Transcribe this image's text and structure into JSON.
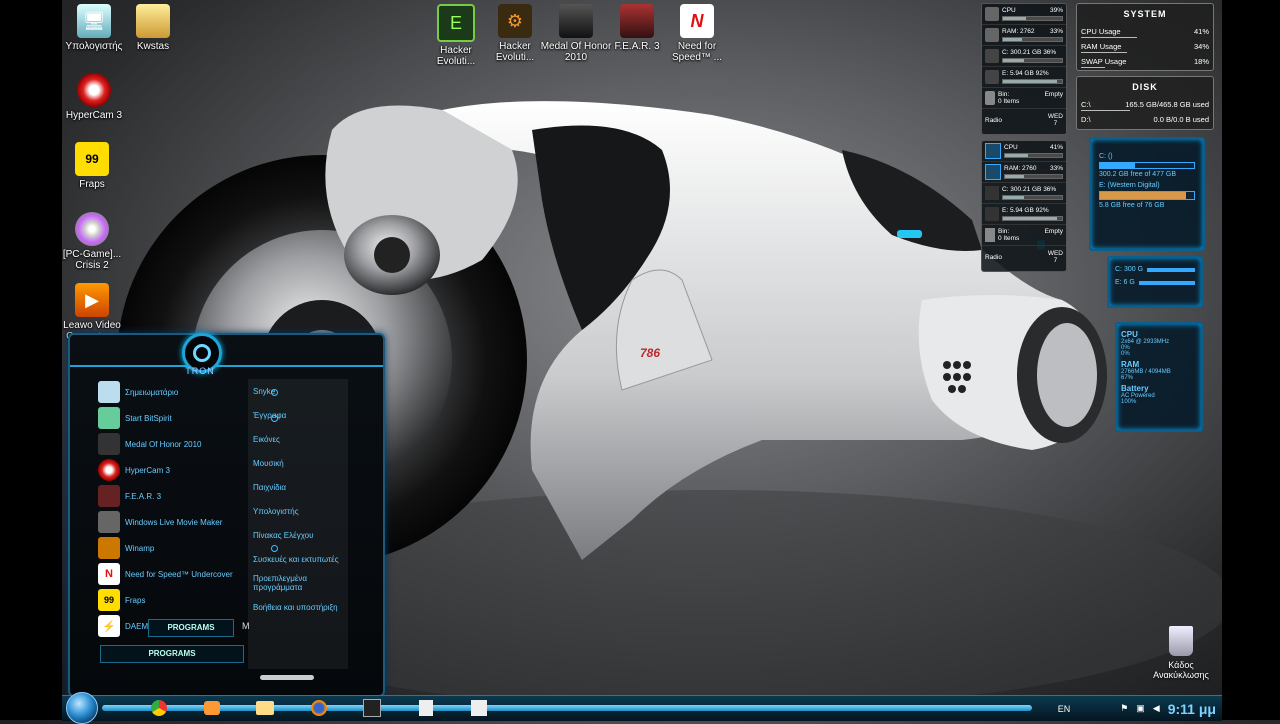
{
  "desktop_icons": [
    {
      "label": "Υπολογιστής",
      "icon": "computer-icon"
    },
    {
      "label": "Kwstas",
      "icon": "folder-icon"
    },
    {
      "label": "HyperCam 3",
      "icon": "hypercam-icon"
    },
    {
      "label": "Fraps",
      "icon": "fraps-icon"
    },
    {
      "label": "[PC-Game]... Crisis 2",
      "icon": "disc-icon"
    },
    {
      "label": "Leawo Video Converter...",
      "icon": "video-converter-icon"
    },
    {
      "label": "Hacker Evoluti...",
      "icon": "hacker-evolution-icon"
    },
    {
      "label": "Hacker Evoluti...",
      "icon": "hacker-evolution-2-icon"
    },
    {
      "label": "Medal Of Honor 2010",
      "icon": "medal-of-honor-icon"
    },
    {
      "label": "F.E.A.R. 3",
      "icon": "fear3-icon"
    },
    {
      "label": "Need for Speed™ ...",
      "icon": "need-for-speed-icon"
    }
  ],
  "recycle_bin": {
    "label": "Κάδος Ανακύκλωσης"
  },
  "wallpaper": {
    "bike_number": "786"
  },
  "meter1": {
    "cpu_label": "CPU",
    "cpu_value": "39%",
    "cpu_pct": 39,
    "ram_label": "RAM: 2762",
    "ram_value": "33%",
    "ram_pct": 33,
    "c_drive": "C: 300.21 GB 36%",
    "c_pct": 36,
    "e_drive": "E: 5.94 GB 92%",
    "e_pct": 92,
    "bin_label": "Bin:",
    "bin_status": "Empty",
    "bin_items": "0 Items",
    "radio_label": "Radio",
    "day": "WED",
    "date": "7"
  },
  "meter2": {
    "cpu_label": "CPU",
    "cpu_value": "41%",
    "cpu_pct": 41,
    "ram_label": "RAM: 2760",
    "ram_value": "33%",
    "ram_pct": 33,
    "c_drive": "C: 300.21 GB 36%",
    "c_pct": 36,
    "e_drive": "E: 5.94 GB 92%",
    "e_pct": 92,
    "bin_label": "Bin:",
    "bin_status": "Empty",
    "bin_items": "0 Items",
    "radio_label": "Radio",
    "day": "WED",
    "date": "7"
  },
  "system_gadget": {
    "title": "SYSTEM",
    "rows": [
      {
        "label": "CPU Usage",
        "value": "41%",
        "pct": 41
      },
      {
        "label": "RAM Usage",
        "value": "34%",
        "pct": 34
      },
      {
        "label": "SWAP Usage",
        "value": "18%",
        "pct": 18
      }
    ]
  },
  "disk_gadget": {
    "title": "DISK",
    "rows": [
      {
        "label": "C:\\",
        "value": "165.5 GB/465.8 GB used",
        "pct": 36
      },
      {
        "label": "D:\\",
        "value": "0.0 B/0.0 B used",
        "pct": 0
      }
    ]
  },
  "drive_gadget": {
    "c_label": "C: ()",
    "c_free": "300.2 GB free of 477 GB",
    "c_pct": 37,
    "e_label": "E: (Western Digital)",
    "e_free": "5.8 GB free of 76 GB",
    "e_pct": 92
  },
  "small_drive_gadget": {
    "c": "C: 300 G",
    "e": "E: 6 G"
  },
  "cpu_gadget": {
    "cpu_title": "CPU",
    "cpu_spec": "2x64 @ 2933MHz",
    "core1": "0%",
    "core2": "0%",
    "ram_title": "RAM",
    "ram_value": "2766MB / 4094MB",
    "ram_pct": "67%",
    "battery_title": "Battery",
    "battery_status": "AC Powered",
    "battery_pct": "100%"
  },
  "start_menu": {
    "title": "TRON",
    "items": [
      {
        "label": "Σημειωματάριο",
        "icon": "notepad-icon"
      },
      {
        "label": "Start BitSpirit",
        "icon": "bitspirit-icon"
      },
      {
        "label": "Medal Of Honor 2010",
        "icon": "medal-of-honor-icon"
      },
      {
        "label": "HyperCam 3",
        "icon": "hypercam-icon"
      },
      {
        "label": "F.E.A.R. 3",
        "icon": "fear3-icon"
      },
      {
        "label": "Windows Live Movie Maker",
        "icon": "movie-maker-icon"
      },
      {
        "label": "Winamp",
        "icon": "winamp-icon"
      },
      {
        "label": "Need for Speed™ Undercover",
        "icon": "need-for-speed-icon"
      },
      {
        "label": "Fraps",
        "icon": "fraps-icon"
      },
      {
        "label": "DAEMON",
        "icon": "daemon-tools-icon"
      }
    ],
    "places": [
      "Snyke",
      "Έγγραφα",
      "Εικόνες",
      "Μουσική",
      "Παιχνίδια",
      "Υπολογιστής",
      "Πίνακας Ελέγχου",
      "Συσκευές και εκτυπωτές",
      "Προεπιλεγμένα προγράμματα",
      "Βοήθεια και υποστήριξη"
    ],
    "programs_label": "PROGRAMS",
    "programs_label_2": "PROGRAMS",
    "overflow_label": "M"
  },
  "taskbar": {
    "language": "EN",
    "clock": "9:11 μμ",
    "pinned": [
      "chrome-icon",
      "media-player-icon",
      "explorer-icon",
      "firefox-icon",
      "need-for-speed-icon",
      "notepad-icon",
      "counter-strike-icon"
    ]
  }
}
